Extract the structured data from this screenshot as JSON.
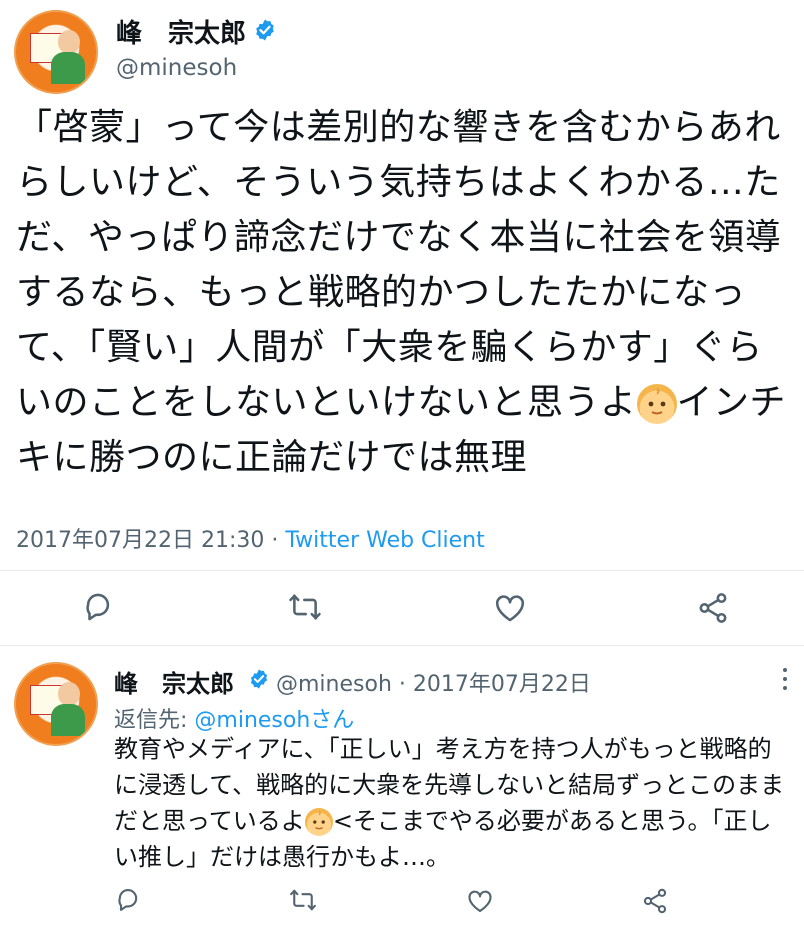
{
  "main_tweet": {
    "author_name": "峰　宗太郎",
    "handle": "@minesoh",
    "text_before_emoji": "「啓蒙」って今は差別的な響きを含むからあれらしいけど、そういう気持ちはよくわかる…ただ、やっぱり諦念だけでなく本当に社会を領導するなら、もっと戦略的かつしたたかになって、「賢い」人間が「大衆を騙くらかす」ぐらいのことをしないといけないと思うよ",
    "text_after_emoji": "インチキに勝つのに正論だけでは無理",
    "emoji_icon": "baby-face-emoji",
    "timestamp": "2017年07月22日 21:30",
    "separator": "·",
    "client": "Twitter Web Client"
  },
  "reply_tweet": {
    "author_name": "峰　宗太郎",
    "handle": "@minesoh",
    "date": "· 2017年07月22日",
    "reply_prefix": "返信先: ",
    "reply_to": "@minesohさん",
    "text_before_emoji": "教育やメディアに、「正しい」考え方を持つ人がもっと戦略的に浸透して、戦略的に大衆を先導しないと結局ずっとこのままだと思っているよ",
    "text_after_emoji": "<そこまでやる必要があると思う。「正しい推し」だけは愚行かもよ…。",
    "emoji_icon": "baby-face-emoji"
  },
  "icons": [
    "verified-badge-icon",
    "reply-icon",
    "retweet-icon",
    "like-icon",
    "share-icon",
    "more-icon"
  ],
  "colors": {
    "accent": "#1d9bf0",
    "muted": "#536471",
    "text": "#0f1419",
    "avatar_orange": "#f07e1f"
  }
}
